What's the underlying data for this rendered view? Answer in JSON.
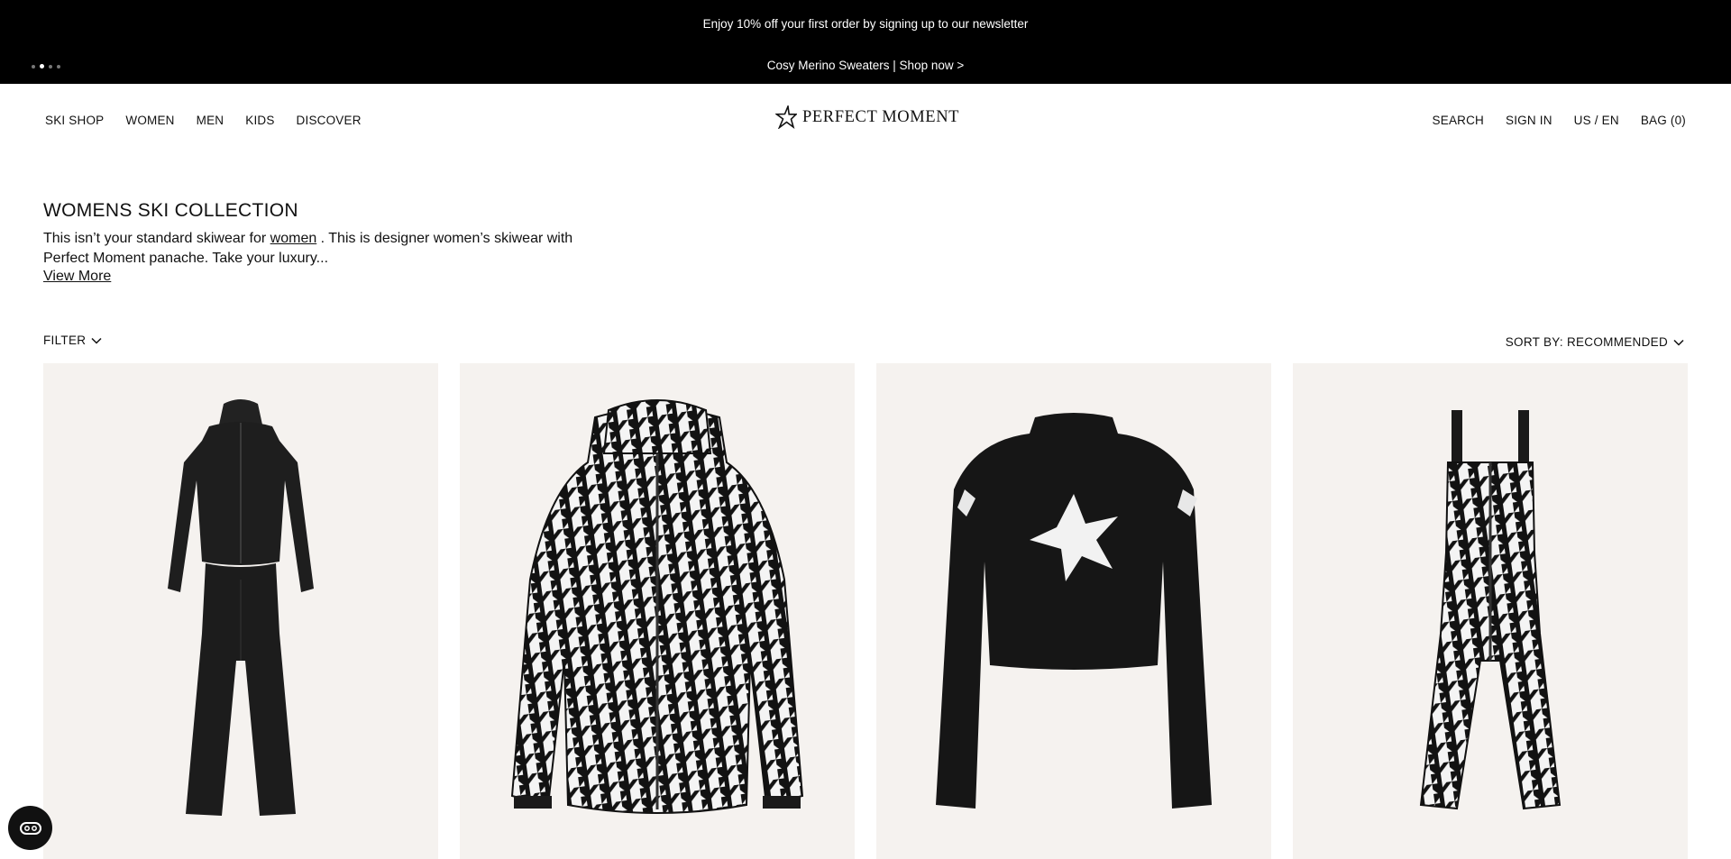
{
  "announcement": {
    "line1": "Enjoy 10% off your first order by signing up to our newsletter",
    "line2": "Cosy Merino Sweaters | Shop now >",
    "slide_count": 4,
    "active_slide": 2
  },
  "header": {
    "nav_left": [
      "SKI SHOP",
      "WOMEN",
      "MEN",
      "KIDS",
      "DISCOVER"
    ],
    "logo_text": "PERFECT MOMENT",
    "nav_right": {
      "search": "SEARCH",
      "sign_in": "SIGN IN",
      "locale": "US / EN",
      "bag": "BAG (0)"
    }
  },
  "collection": {
    "title": "WOMENS SKI COLLECTION",
    "intro_before": "This isn’t your standard skiwear for ",
    "intro_link": "women",
    "intro_after": " . This is designer women’s skiwear with Perfect Moment panache. Take your luxury...",
    "view_more": "View More"
  },
  "controls": {
    "filter_label": "FILTER",
    "sort_label": "SORT BY: RECOMMENDED"
  },
  "products": [
    {
      "image": "black-jacket-and-flared-pants",
      "color": "#1b1b1b"
    },
    {
      "image": "houndstooth-puffer-jacket",
      "color": "#111111"
    },
    {
      "image": "black-star-sweater",
      "color": "#151515"
    },
    {
      "image": "houndstooth-ski-bib",
      "color": "#111111"
    }
  ],
  "colors": {
    "announcement_bg": "#000000",
    "card_bg": "#f5f2ef",
    "text": "#111111"
  },
  "icons": {
    "logo": "star-icon",
    "chevron": "chevron-down-icon",
    "chat": "chat-icon"
  }
}
